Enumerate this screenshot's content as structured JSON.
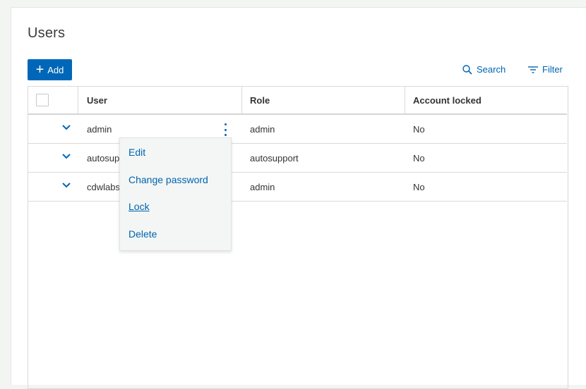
{
  "page": {
    "title": "Users"
  },
  "toolbar": {
    "add_label": "Add",
    "search_label": "Search",
    "filter_label": "Filter"
  },
  "table": {
    "columns": [
      "User",
      "Role",
      "Account locked"
    ],
    "rows": [
      {
        "user": "admin",
        "role": "admin",
        "locked": "No"
      },
      {
        "user": "autosupport",
        "role": "autosupport",
        "locked": "No"
      },
      {
        "user": "cdwlabsadmin",
        "role": "admin",
        "locked": "No"
      }
    ]
  },
  "context_menu": {
    "items": [
      "Edit",
      "Change password",
      "Lock",
      "Delete"
    ]
  },
  "colors": {
    "accent": "#0067b8",
    "link": "#0063b1"
  }
}
